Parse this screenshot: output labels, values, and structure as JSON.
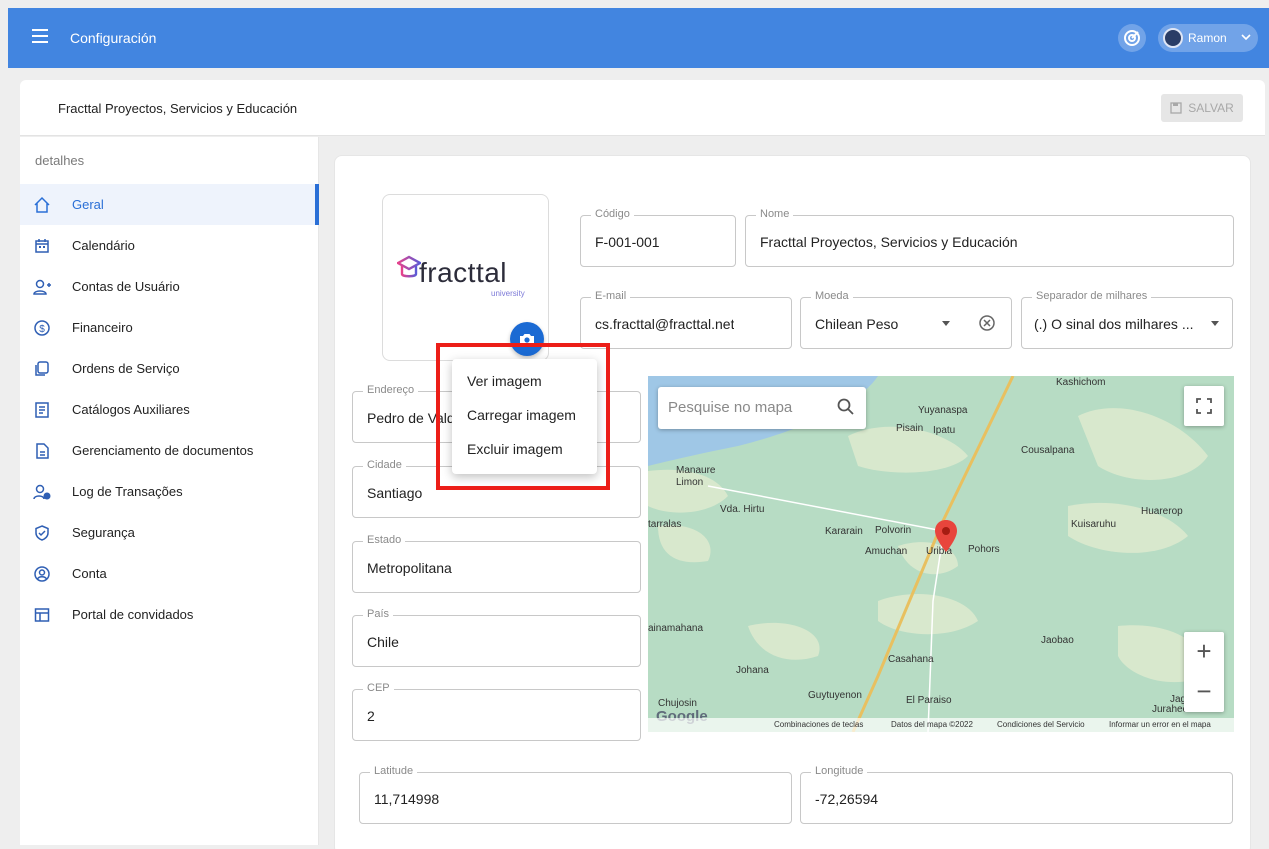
{
  "topbar": {
    "title": "Configuración",
    "user_name": "Ramon",
    "icons": {
      "menu": "hamburger-menu-icon",
      "goal": "goal-target-icon",
      "caret": "chevron-down-icon"
    },
    "colors": {
      "bar": "#4285e0"
    }
  },
  "header": {
    "company_title": "Fracttal Proyectos, Servicios y Educación",
    "save_label": "SALVAR"
  },
  "sidebar": {
    "heading": "detalhes",
    "items": [
      {
        "label": "Geral",
        "icon": "home-icon",
        "active": true
      },
      {
        "label": "Calendário",
        "icon": "calendar-icon"
      },
      {
        "label": "Contas de Usuário",
        "icon": "add-user-icon"
      },
      {
        "label": "Financeiro",
        "icon": "dollar-icon"
      },
      {
        "label": "Ordens de Serviço",
        "icon": "work-order-icon"
      },
      {
        "label": "Catálogos Auxiliares",
        "icon": "catalog-icon"
      },
      {
        "label": "Gerenciamento de documentos",
        "icon": "document-icon"
      },
      {
        "label": "Log de Transações",
        "icon": "user-log-icon"
      },
      {
        "label": "Segurança",
        "icon": "shield-icon"
      },
      {
        "label": "Conta",
        "icon": "account-icon"
      },
      {
        "label": "Portal de convidados",
        "icon": "portal-icon"
      }
    ],
    "accent": "#2a6fd6"
  },
  "logo": {
    "word": "fracttal",
    "sub": "university"
  },
  "form": {
    "codigo": {
      "label": "Código",
      "value": "F-001-001"
    },
    "nome": {
      "label": "Nome",
      "value": "Fracttal Proyectos, Servicios y Educación"
    },
    "email": {
      "label": "E-mail",
      "value": "cs.fracttal@fracttal.net"
    },
    "moeda": {
      "label": "Moeda",
      "value": "Chilean Peso"
    },
    "separador": {
      "label": "Separador de milhares",
      "value": "(.) O sinal dos milhares ..."
    },
    "endereco": {
      "label": "Endereço",
      "value": "Pedro de Valdivia"
    },
    "cidade": {
      "label": "Cidade",
      "value": "Santiago"
    },
    "estado": {
      "label": "Estado",
      "value": "Metropolitana"
    },
    "pais": {
      "label": "País",
      "value": "Chile"
    },
    "cep": {
      "label": "CEP",
      "value": "2"
    },
    "latitude": {
      "label": "Latitude",
      "value": "11,714998"
    },
    "longitude": {
      "label": "Longitude",
      "value": "-72,26594"
    }
  },
  "context_menu": {
    "items": [
      "Ver imagem",
      "Carregar imagem",
      "Excluir imagem"
    ],
    "highlight_color": "#ec1e18"
  },
  "map": {
    "search_placeholder": "Pesquise no mapa",
    "zoom_in": "+",
    "zoom_out": "−",
    "google": "Google",
    "places": [
      "Kashichom",
      "Yuyanaspa",
      "Pisain",
      "Ipatu",
      "Cousalpana",
      "Manaure",
      "Limon",
      "Vda. Hirtu",
      "tarralas",
      "Kararain",
      "Polvorin",
      "Amuchan",
      "Uribia",
      "Pohors",
      "Huarerop",
      "Kuisaruhu",
      "ainamahana",
      "Jaobao",
      "Casahana",
      "Johana",
      "Guytuyenon",
      "El Paraiso",
      "Chujosin",
      "Jagu",
      "Jurahechon"
    ],
    "attribution": [
      "Combinaciones de teclas",
      "Datos del mapa ©2022",
      "Condiciones del Servicio",
      "Informar un error en el mapa"
    ]
  }
}
